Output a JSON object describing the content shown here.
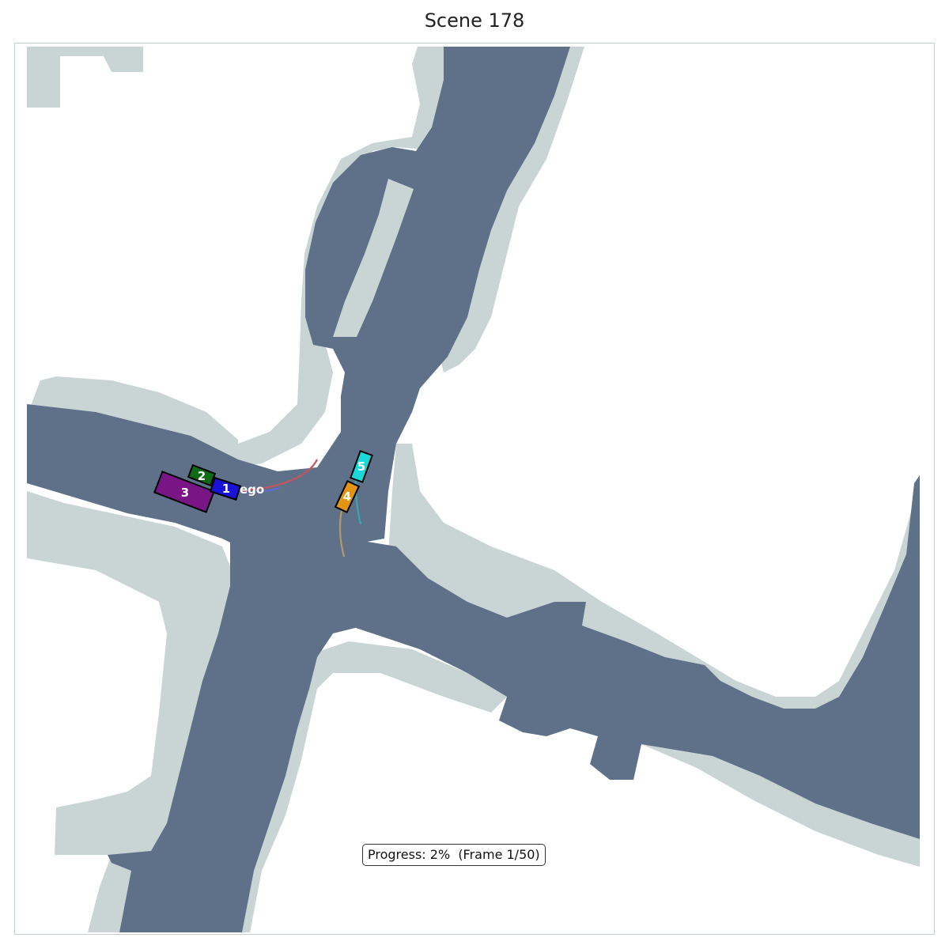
{
  "title": "Scene 178",
  "progress_text": "Progress: 2%  (Frame 1/50)",
  "colors": {
    "road": "#5e7189",
    "sidewalk": "#c9d5d5",
    "lane_edge": "#a6b5bd",
    "background": "#ffffff",
    "frame_border": "#c3cdcd"
  },
  "ego_label": "ego",
  "vehicles": [
    {
      "id": "1",
      "label": "1",
      "color": "#1a12d6",
      "is_ego": true
    },
    {
      "id": "2",
      "label": "2",
      "color": "#0f6a17"
    },
    {
      "id": "3",
      "label": "3",
      "color": "#7a1585"
    },
    {
      "id": "4",
      "label": "4",
      "color": "#e39415"
    },
    {
      "id": "5",
      "label": "5",
      "color": "#1ad8d8"
    }
  ],
  "trajectories": [
    {
      "vehicle": "1",
      "color": "#c0545f"
    },
    {
      "vehicle": "4",
      "color": "#b59866"
    },
    {
      "vehicle": "5",
      "color": "#3aa8aa"
    }
  ]
}
